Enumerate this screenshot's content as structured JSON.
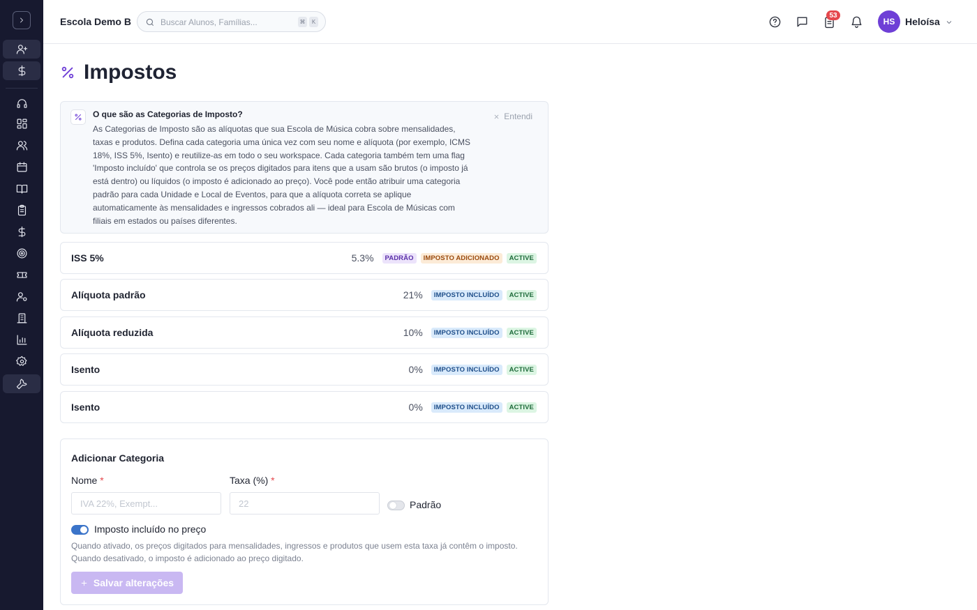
{
  "header": {
    "school_name": "Escola Demo B",
    "search_placeholder": "Buscar Alunos, Famílias...",
    "search_shortcut": [
      "⌘",
      "K"
    ],
    "notifications_count": "53",
    "avatar_initials": "HS",
    "user_name": "Heloísa"
  },
  "sidebar": {
    "items": [
      {
        "icon": "user-plus-icon"
      },
      {
        "icon": "dollar-icon"
      },
      {
        "icon": "headset-icon"
      },
      {
        "icon": "dashboard-icon"
      },
      {
        "icon": "users-icon"
      },
      {
        "icon": "calendar-icon"
      },
      {
        "icon": "book-icon"
      },
      {
        "icon": "clipboard-icon"
      },
      {
        "icon": "dollar-icon"
      },
      {
        "icon": "target-icon"
      },
      {
        "icon": "ticket-icon"
      },
      {
        "icon": "user-settings-icon"
      },
      {
        "icon": "building-icon"
      },
      {
        "icon": "bar-chart-icon"
      },
      {
        "icon": "gear-icon"
      },
      {
        "icon": "wrench-icon"
      }
    ]
  },
  "page": {
    "title": "Impostos"
  },
  "info": {
    "title": "O que são as Categorias de Imposto?",
    "body": "As Categorias de Imposto são as alíquotas que sua Escola de Música cobra sobre mensalidades, taxas e produtos. Defina cada categoria uma única vez com seu nome e alíquota (por exemplo, ICMS 18%, ISS 5%, Isento) e reutilize-as em todo o seu workspace. Cada categoria também tem uma flag 'Imposto incluído' que controla se os preços digitados para itens que a usam são brutos (o imposto já está dentro) ou líquidos (o imposto é adicionado ao preço). Você pode então atribuir uma categoria padrão para cada Unidade e Local de Eventos, para que a alíquota correta se aplique automaticamente às mensalidades e ingressos cobrados ali — ideal para Escola de Músicas com filiais em estados ou países diferentes.",
    "dismiss_label": "Entendi"
  },
  "categories": [
    {
      "name": "ISS 5%",
      "rate": "5.3%",
      "default_badge": "PADRÃO",
      "mode_badge": "IMPOSTO ADICIONADO",
      "status": "ACTIVE"
    },
    {
      "name": "Alíquota padrão",
      "rate": "21%",
      "default_badge": "",
      "mode_badge": "IMPOSTO INCLUÍDO",
      "status": "ACTIVE"
    },
    {
      "name": "Alíquota reduzida",
      "rate": "10%",
      "default_badge": "",
      "mode_badge": "IMPOSTO INCLUÍDO",
      "status": "ACTIVE"
    },
    {
      "name": "Isento",
      "rate": "0%",
      "default_badge": "",
      "mode_badge": "IMPOSTO INCLUÍDO",
      "status": "ACTIVE"
    },
    {
      "name": "Isento",
      "rate": "0%",
      "default_badge": "",
      "mode_badge": "IMPOSTO INCLUÍDO",
      "status": "ACTIVE"
    }
  ],
  "form": {
    "title": "Adicionar Categoria",
    "name_label": "Nome",
    "name_placeholder": "IVA 22%, Exempt...",
    "name_value": "",
    "rate_label": "Taxa (%)",
    "rate_placeholder": "22",
    "rate_value": "",
    "required_mark": "*",
    "default_label": "Padrão",
    "default_on": false,
    "included_label": "Imposto incluído no preço",
    "included_on": true,
    "help_text": "Quando ativado, os preços digitados para mensalidades, ingressos e produtos que usem esta taxa já contêm o imposto. Quando desativado, o imposto é adicionado ao preço digitado.",
    "save_label": "Salvar alterações"
  },
  "colors": {
    "sidebar_bg": "#17192f",
    "accent": "#6e3fd6",
    "toggle_on": "#3b74c9",
    "badge_red": "#e5484d"
  }
}
